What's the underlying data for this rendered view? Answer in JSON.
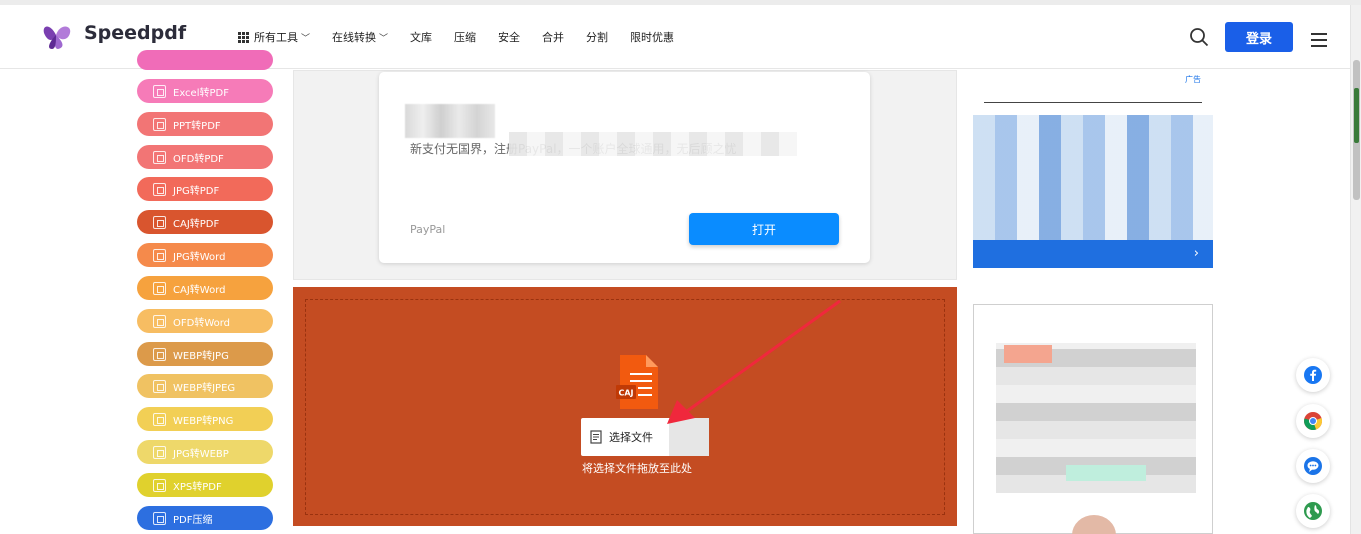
{
  "header": {
    "brand": "Speedpdf",
    "nav": [
      {
        "label": "所有工具",
        "has_menu": true,
        "icon": "grid-icon"
      },
      {
        "label": "在线转换",
        "has_menu": true
      },
      {
        "label": "文库",
        "has_menu": false
      },
      {
        "label": "压缩",
        "has_menu": false
      },
      {
        "label": "安全",
        "has_menu": false
      },
      {
        "label": "合并",
        "has_menu": false
      },
      {
        "label": "分割",
        "has_menu": false
      },
      {
        "label": "限时优惠",
        "has_menu": false
      }
    ],
    "login_label": "登录"
  },
  "tools": [
    {
      "label": "Excel转PDF",
      "color": "#f67bb8"
    },
    {
      "label": "PPT转PDF",
      "color": "#f27575"
    },
    {
      "label": "OFD转PDF",
      "color": "#f27575"
    },
    {
      "label": "JPG转PDF",
      "color": "#f26a5a"
    },
    {
      "label": "CAJ转PDF",
      "color": "#d9552e"
    },
    {
      "label": "JPG转Word",
      "color": "#f58a4b"
    },
    {
      "label": "CAJ转Word",
      "color": "#f6a23e"
    },
    {
      "label": "OFD转Word",
      "color": "#f7bd62"
    },
    {
      "label": "WEBP转JPG",
      "color": "#dc9a4a"
    },
    {
      "label": "WEBP转JPEG",
      "color": "#f0c262"
    },
    {
      "label": "WEBP转PNG",
      "color": "#f2cf55"
    },
    {
      "label": "JPG转WEBP",
      "color": "#eed86a"
    },
    {
      "label": "XPS转PDF",
      "color": "#e0d12d"
    },
    {
      "label": "PDF压缩",
      "color": "#2d6fe0"
    }
  ],
  "ad": {
    "text": "新支付无国界，注册PayPal，一个账户全球通用，无后顾之忧",
    "brand": "PayPal",
    "open_label": "打开"
  },
  "upload": {
    "file_badge": "CAJ",
    "choose_label": "选择文件",
    "drop_hint": "将选择文件拖放至此处",
    "color": "#c44c22"
  },
  "right_ad": {
    "tag": "广告"
  },
  "float": [
    {
      "icon": "facebook-icon"
    },
    {
      "icon": "chrome-icon"
    },
    {
      "icon": "chat-icon"
    },
    {
      "icon": "globe-icon"
    }
  ]
}
